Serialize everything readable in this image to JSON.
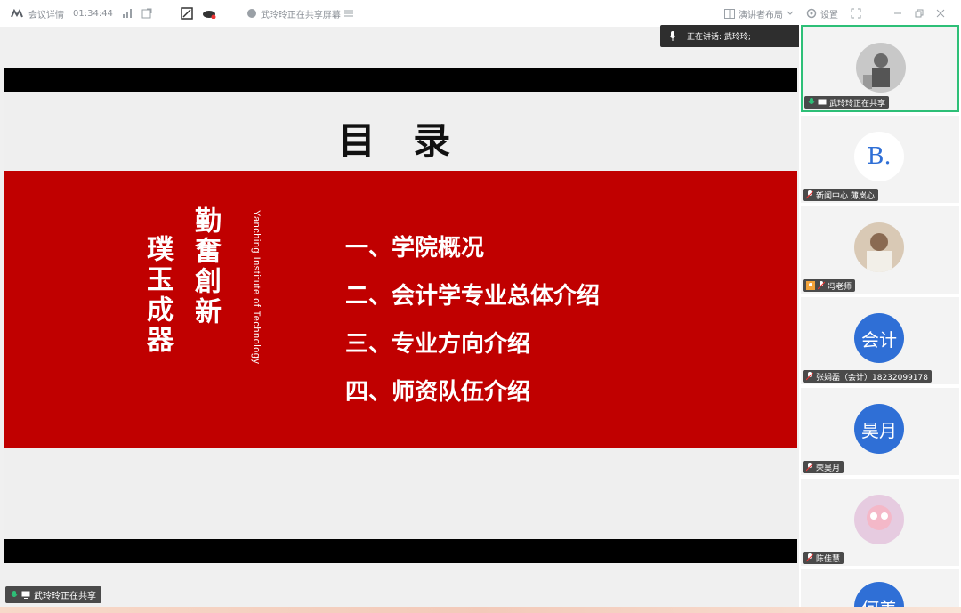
{
  "titlebar": {
    "meeting_details": "会议详情",
    "elapsed": "01:34:44",
    "sharing_status": "武玲玲正在共享屏幕",
    "layout_button": "演讲者布局",
    "settings_button": "设置"
  },
  "speaking_banner": {
    "label": "正在讲话:",
    "name": "武玲玲;"
  },
  "slide": {
    "title": "目 录",
    "calligraphy_right": "勤奮創新",
    "calligraphy_left": "璞玉成器",
    "institute": "Yanching Institute of Technology",
    "toc": [
      "一、学院概况",
      "二、会计学专业总体介绍",
      "三、专业方向介绍",
      "四、师资队伍介绍"
    ]
  },
  "bottom_share_label": "武玲玲正在共享",
  "participants": [
    {
      "label": "武玲玲正在共享",
      "avatar_text": "",
      "avatar_color": "#c8c8c8",
      "active": true
    },
    {
      "label": "新闻中心 薄岚心",
      "avatar_text": "B.",
      "avatar_color": "#ffffff",
      "active": false
    },
    {
      "label": "冯老师",
      "avatar_text": "",
      "avatar_color": "#d9c9b5",
      "active": false
    },
    {
      "label": "张娟磊（会计）18232099178",
      "avatar_text": "会计",
      "avatar_color": "#2f6fd6",
      "active": false
    },
    {
      "label": "荣昊月",
      "avatar_text": "昊月",
      "avatar_color": "#2f6fd6",
      "active": false
    },
    {
      "label": "陈佳慧",
      "avatar_text": "",
      "avatar_color": "#e6cbe0",
      "active": false
    },
    {
      "label": "",
      "avatar_text": "何美",
      "avatar_color": "#2f6fd6",
      "active": false
    }
  ],
  "colors": {
    "accent_green": "#2dbf77",
    "slide_red": "#c00000",
    "avatar_blue": "#2f6fd6"
  }
}
